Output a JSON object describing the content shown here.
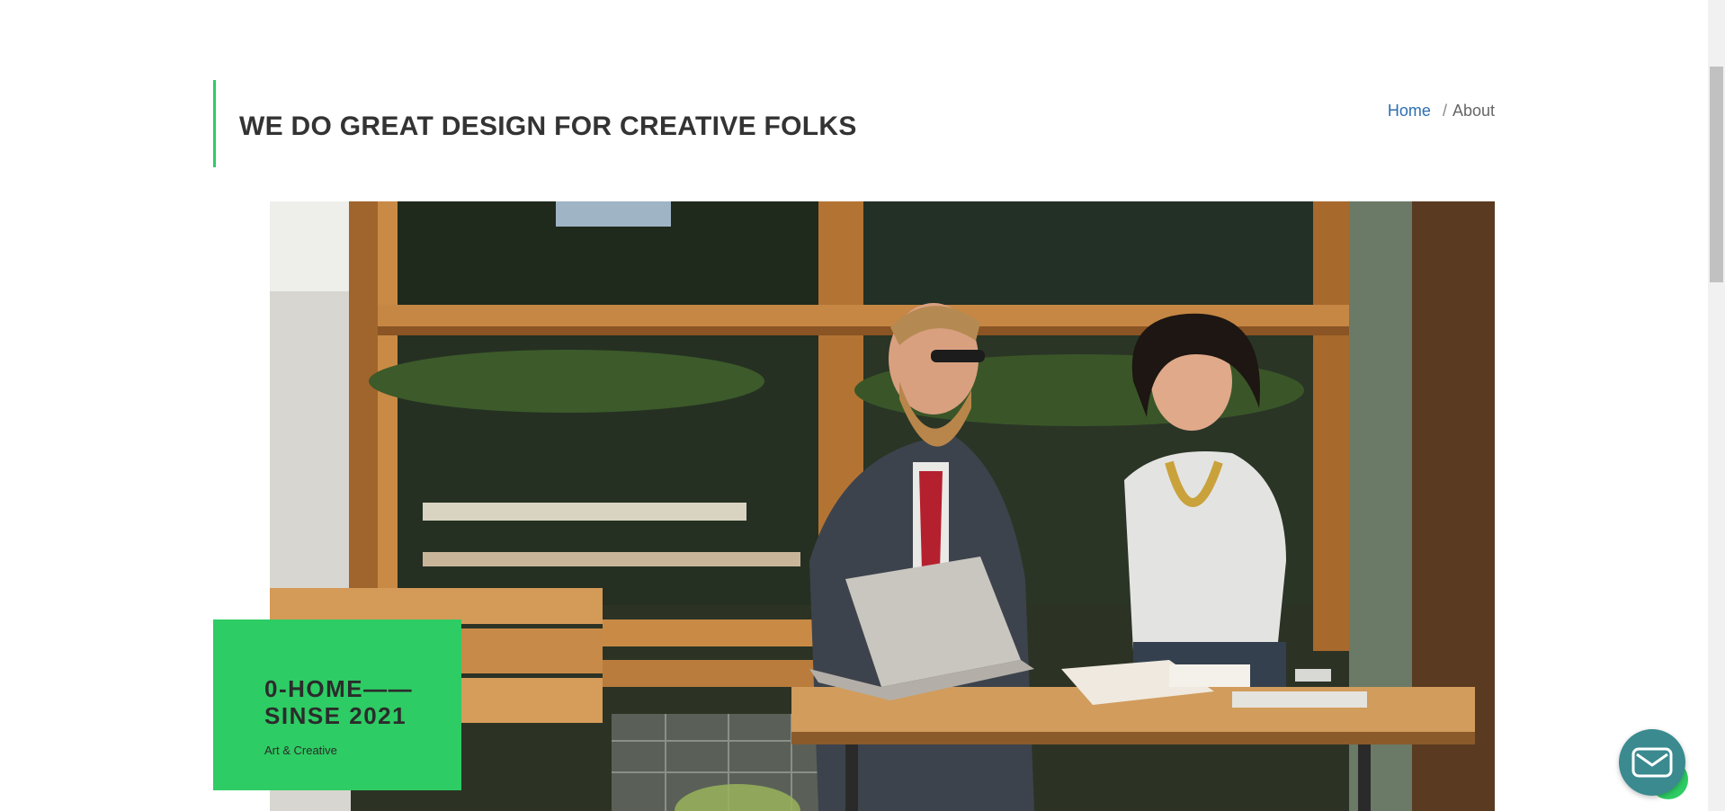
{
  "header": {
    "title": "WE DO GREAT DESIGN FOR CREATIVE FOLKS"
  },
  "breadcrumb": {
    "home": "Home",
    "separator": "/",
    "current": "About"
  },
  "badge": {
    "line1": "0-HOME——",
    "line2": "SINSE 2021",
    "subtitle": "Art & Creative"
  },
  "hero": {
    "description_icon": "hero-photo"
  },
  "chat": {
    "icon": "envelope-icon"
  },
  "colors": {
    "accent": "#2ecc64",
    "link": "#2d6fb0",
    "heading": "#333333",
    "chat": "#3a8a8f"
  }
}
